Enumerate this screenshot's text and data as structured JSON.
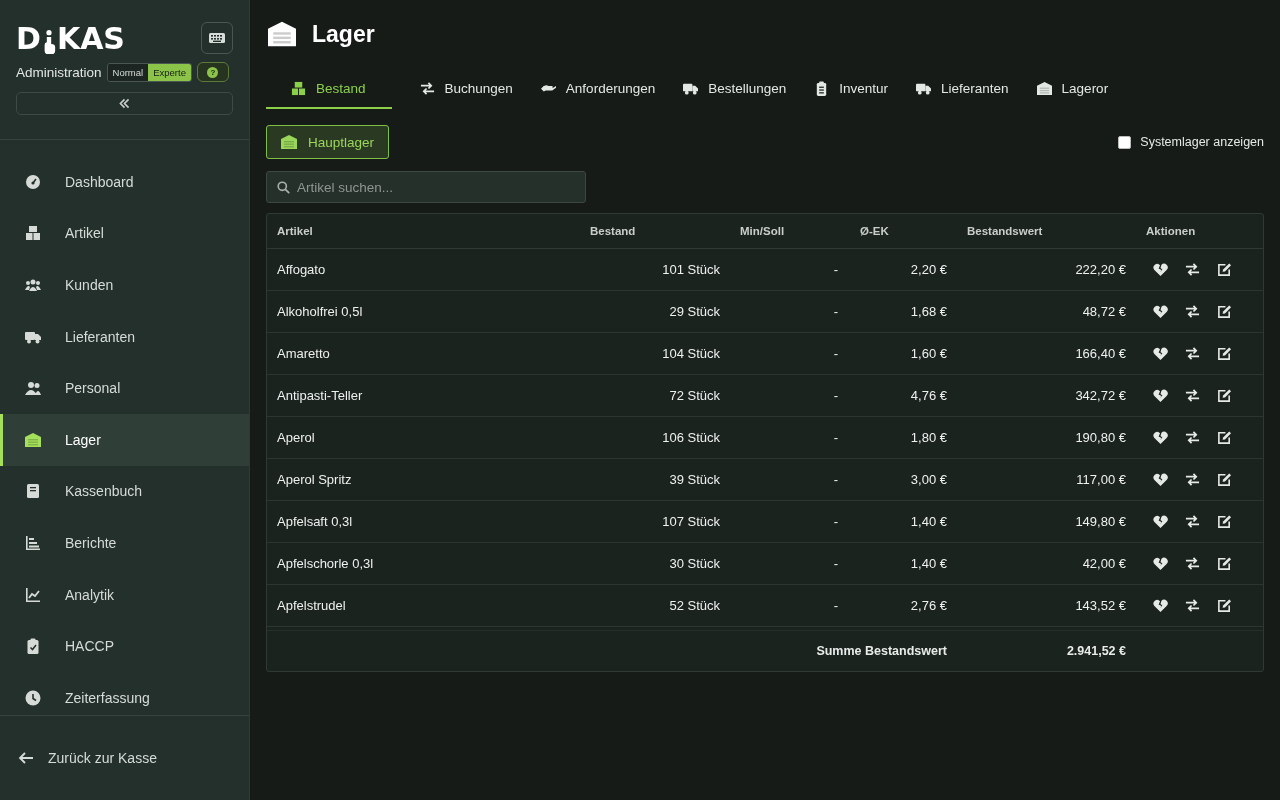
{
  "sidebar": {
    "logo": {
      "before": "D",
      "after": "KAS"
    },
    "subtitle": "Administration",
    "modes": [
      {
        "label": "Normal",
        "selected": false
      },
      {
        "label": "Experte",
        "selected": true
      }
    ],
    "help": "?",
    "items": [
      {
        "label": "Dashboard",
        "selected": false
      },
      {
        "label": "Artikel",
        "selected": false
      },
      {
        "label": "Kunden",
        "selected": false
      },
      {
        "label": "Lieferanten",
        "selected": false
      },
      {
        "label": "Personal",
        "selected": false
      },
      {
        "label": "Lager",
        "selected": true
      },
      {
        "label": "Kassenbuch",
        "selected": false
      },
      {
        "label": "Berichte",
        "selected": false
      },
      {
        "label": "Analytik",
        "selected": false
      },
      {
        "label": "HACCP",
        "selected": false
      },
      {
        "label": "Zeiterfassung",
        "selected": false
      }
    ],
    "back": "Zurück zur Kasse"
  },
  "page": {
    "title": "Lager",
    "tabs": [
      {
        "label": "Bestand",
        "selected": true
      },
      {
        "label": "Buchungen",
        "selected": false
      },
      {
        "label": "Anforderungen",
        "selected": false
      },
      {
        "label": "Bestellungen",
        "selected": false
      },
      {
        "label": "Inventur",
        "selected": false
      },
      {
        "label": "Lieferanten",
        "selected": false
      },
      {
        "label": "Lageror",
        "selected": false
      }
    ],
    "warehouse_button": "Hauptlager",
    "system_checkbox": {
      "label": "Systemlager anzeigen",
      "checked": false
    },
    "search": {
      "placeholder": "Artikel suchen..."
    }
  },
  "table": {
    "columns": [
      "Artikel",
      "Bestand",
      "Min/Soll",
      "Ø-EK",
      "Bestandswert",
      "Aktionen"
    ],
    "rows": [
      [
        "Affogato",
        "101 Stück",
        "-",
        "2,20 €",
        "222,20 €"
      ],
      [
        "Alkoholfrei 0,5l",
        "29 Stück",
        "-",
        "1,68 €",
        "48,72 €"
      ],
      [
        "Amaretto",
        "104 Stück",
        "-",
        "1,60 €",
        "166,40 €"
      ],
      [
        "Antipasti-Teller",
        "72 Stück",
        "-",
        "4,76 €",
        "342,72 €"
      ],
      [
        "Aperol",
        "106 Stück",
        "-",
        "1,80 €",
        "190,80 €"
      ],
      [
        "Aperol Spritz",
        "39 Stück",
        "-",
        "3,00 €",
        "117,00 €"
      ],
      [
        "Apfelsaft 0,3l",
        "107 Stück",
        "-",
        "1,40 €",
        "149,80 €"
      ],
      [
        "Apfelschorle 0,3l",
        "30 Stück",
        "-",
        "1,40 €",
        "42,00 €"
      ],
      [
        "Apfelstrudel",
        "52 Stück",
        "-",
        "2,76 €",
        "143,52 €"
      ]
    ],
    "total_label": "Summe Bestandswert",
    "total": "2.941,52 €"
  }
}
